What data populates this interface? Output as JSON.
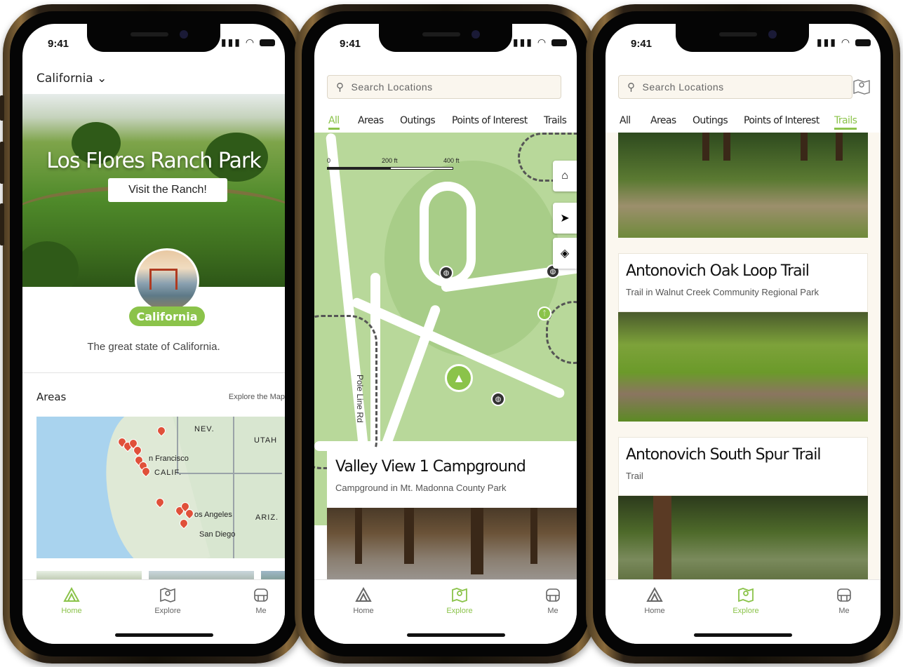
{
  "status": {
    "time": "9:41"
  },
  "screens": {
    "home": {
      "region": "California ⌄",
      "hero_title": "Los Flores Ranch Park",
      "hero_button": "Visit the Ranch!",
      "state_badge": "California",
      "state_desc": "The great state of California.",
      "areas_title": "Areas",
      "explore_link": "Explore the Map",
      "map_labels": {
        "nev": "NEV.",
        "utah": "UTAH",
        "sf": "n Francisco",
        "calif": "CALIF.",
        "la": "os Angeles",
        "ariz": "ARIZ.",
        "sd": "San Diego"
      }
    },
    "explore": {
      "search_placeholder": "Search Locations",
      "tabs": [
        "All",
        "Areas",
        "Outings",
        "Points of Interest",
        "Trails"
      ],
      "active_tab": "All",
      "scale": [
        "0",
        "200 ft",
        "400 ft"
      ],
      "road_label": "Pole Line Rd",
      "result_title": "Valley View 1 Campground",
      "result_sub": "Campground in Mt. Madonna County Park"
    },
    "trails": {
      "search_placeholder": "Search Locations",
      "tabs": [
        "All",
        "Areas",
        "Outings",
        "Points of Interest",
        "Trails"
      ],
      "active_tab": "Trails",
      "cards": [
        {
          "title": "Antonovich Oak Loop Trail",
          "sub": "Trail in Walnut Creek Community Regional Park"
        },
        {
          "title": "Antonovich South Spur Trail",
          "sub": "Trail"
        }
      ]
    }
  },
  "tabbar": {
    "home": "Home",
    "explore": "Explore",
    "me": "Me"
  },
  "colors": {
    "accent": "#8bc34a",
    "pin": "#e0503a",
    "map_green": "#b8d89a"
  },
  "icons": [
    "home-icon",
    "explore-icon",
    "me-icon",
    "search-icon",
    "map-toggle-icon",
    "home-map-icon",
    "locate-icon",
    "layers-icon",
    "campground-icon",
    "restroom-icon",
    "hiker-icon"
  ]
}
